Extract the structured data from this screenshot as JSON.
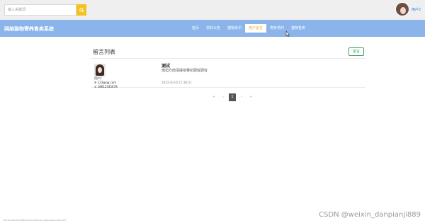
{
  "header": {
    "search": {
      "placeholder": "输入关键词",
      "value": ""
    },
    "user": {
      "name": "用户2"
    }
  },
  "navbar": {
    "site_title": "网络猫物寄养售卖系统",
    "items": [
      {
        "label": "首页",
        "active": false
      },
      {
        "label": "资料公告",
        "active": false
      },
      {
        "label": "猫物资讯",
        "active": false
      },
      {
        "label": "用户留言",
        "active": true
      },
      {
        "label": "寄养预约",
        "active": false
      },
      {
        "label": "猫物售卖",
        "active": false
      }
    ]
  },
  "panel": {
    "title": "留言列表",
    "add_button": "留言",
    "messages": [
      {
        "user_name": "用户2",
        "email": "123@qq.com",
        "phone": "18612345678",
        "title": "测试",
        "content": "南坦方南深撞依赛初顾饭顾有",
        "time": "2023-10-05 17:38:31"
      }
    ]
  },
  "pagination": {
    "first": "«",
    "prev": "‹",
    "current": "1",
    "next": "›",
    "last": "»"
  },
  "status_bar": {
    "url": "30.100.168.220:8080/cs/Tomcat/user_app/users/index.html"
  },
  "watermark": "CSDN @weixin_danpianji889",
  "colors": {
    "navbar": "#8ab4ea",
    "accent": "#f3c31b",
    "active_text": "#f0b020",
    "success": "#3aa35a"
  }
}
